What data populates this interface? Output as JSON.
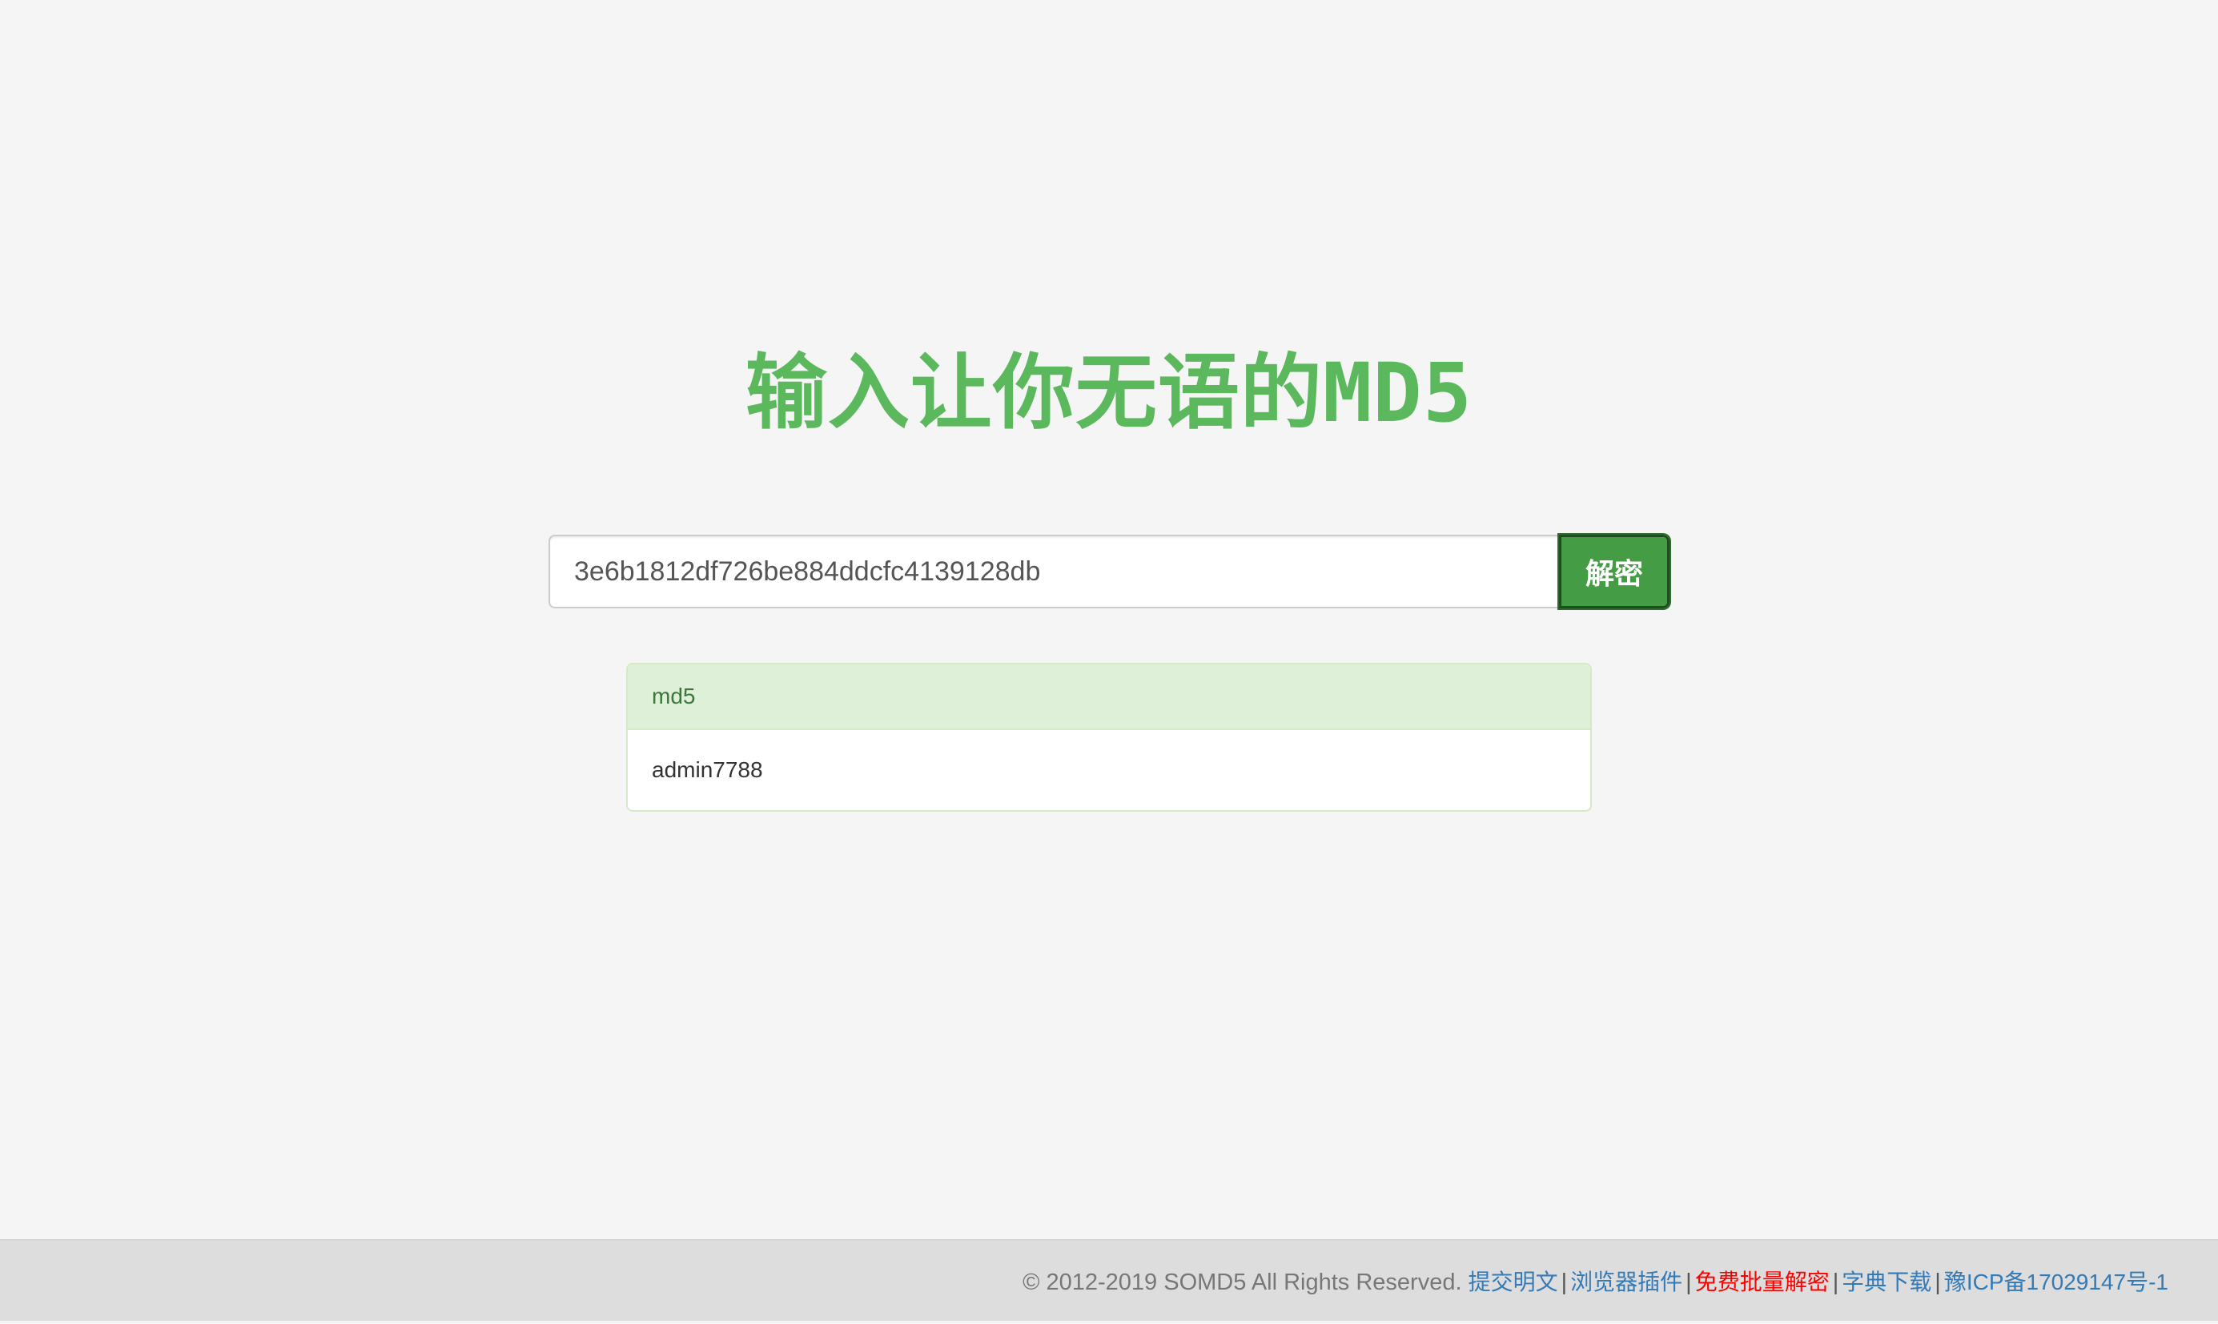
{
  "header": {
    "title": "输入让你无语的MD5"
  },
  "search": {
    "value": "3e6b1812df726be884ddcfc4139128db",
    "button_label": "解密"
  },
  "result": {
    "heading": "md5",
    "value": "admin7788"
  },
  "footer": {
    "copyright": "© 2012-2019 SOMD5 All Rights Reserved.",
    "separator": "|",
    "links": [
      {
        "label": "提交明文"
      },
      {
        "label": "浏览器插件"
      },
      {
        "label": "免费批量解密"
      },
      {
        "label": "字典下载"
      },
      {
        "label": "豫ICP备17029147号-1"
      }
    ]
  },
  "colors": {
    "accent_green": "#5cb85c",
    "button_green": "#449d44",
    "link_blue": "#337ab7",
    "link_red": "#ff0000",
    "panel_heading_bg": "#dff0d8"
  }
}
